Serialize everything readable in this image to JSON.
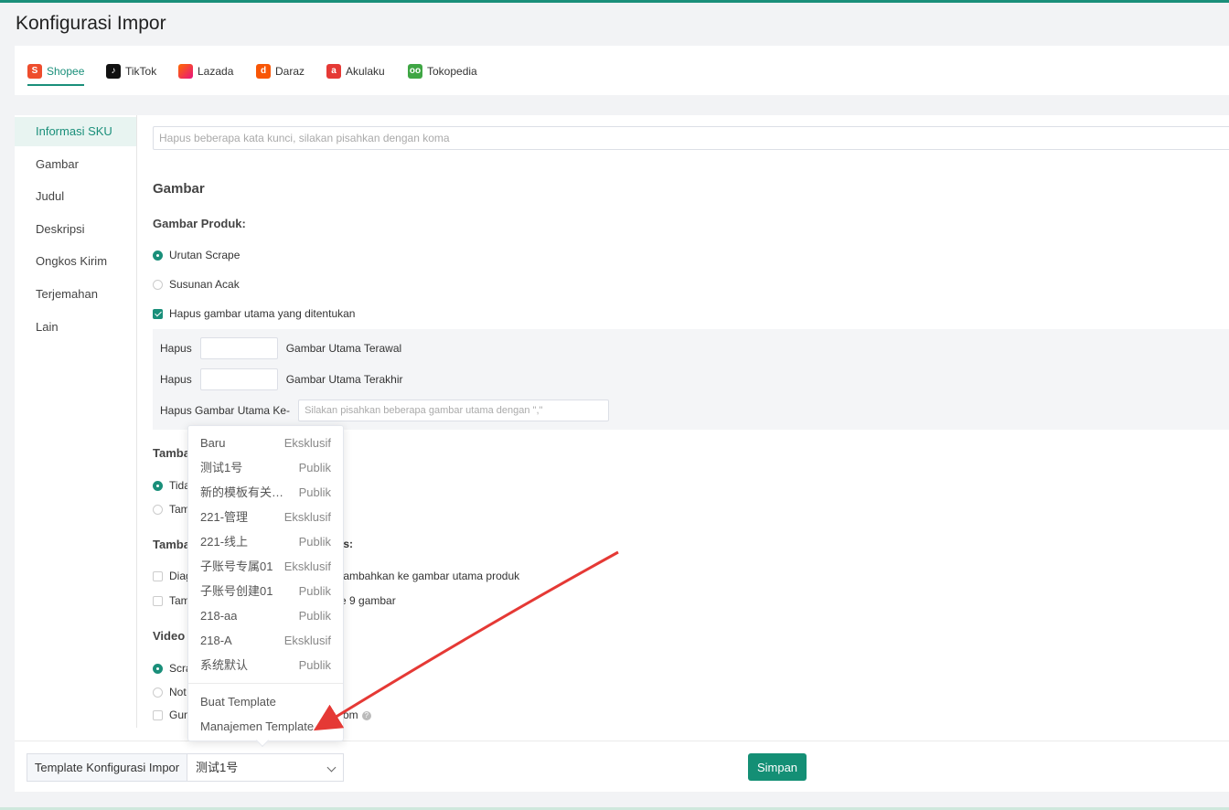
{
  "page": {
    "title": "Konfigurasi Impor"
  },
  "platforms": [
    {
      "label": "Shopee",
      "icon": "shopee-bag-icon",
      "active": true
    },
    {
      "label": "TikTok",
      "icon": "tiktok-icon",
      "active": false
    },
    {
      "label": "Lazada",
      "icon": "lazada-heart-icon",
      "active": false
    },
    {
      "label": "Daraz",
      "icon": "daraz-icon",
      "active": false
    },
    {
      "label": "Akulaku",
      "icon": "akulaku-icon",
      "active": false
    },
    {
      "label": "Tokopedia",
      "icon": "tokopedia-owl-icon",
      "active": false
    }
  ],
  "sidebar": {
    "items": [
      {
        "label": "Informasi SKU",
        "active": true
      },
      {
        "label": "Gambar"
      },
      {
        "label": "Judul"
      },
      {
        "label": "Deskripsi"
      },
      {
        "label": "Ongkos Kirim"
      },
      {
        "label": "Terjemahan"
      },
      {
        "label": "Lain"
      }
    ]
  },
  "keywords": {
    "placeholder": "Hapus beberapa kata kunci, silakan pisahkan dengan koma"
  },
  "gambar": {
    "section_title": "Gambar",
    "product_label": "Gambar Produk:",
    "opt_scrape": "Urutan Scrape",
    "opt_random": "Susunan Acak",
    "remove_main": "Hapus gambar utama yang ditentukan",
    "hapus": "Hapus",
    "first_main": "Gambar Utama Terawal",
    "last_main": "Gambar Utama Terakhir",
    "nth_label": "Hapus Gambar Utama Ke-",
    "nth_placeholder": "Silakan pisahkan beberapa gambar utama dengan \",\""
  },
  "partial": {
    "row1": "Tamba",
    "row2_radio": "Tida",
    "row3_radio": "Tam",
    "row4": "Tamba",
    "row4_tail": "is:",
    "row5_check": "Diag",
    "row5_tail": "tambahkan ke gambar utama produk",
    "row6_check": "Tam",
    "row6_tail": "e 9 gambar",
    "video": "Video",
    "v1": "Scra",
    "v2": "Not",
    "v3": "Gun",
    "v3_tail": "om"
  },
  "dropdown": {
    "items": [
      {
        "name": "Baru",
        "tag": "Eksklusif"
      },
      {
        "name": "测试1号",
        "tag": "Publik"
      },
      {
        "name": "新的模板有关键字",
        "tag": "Publik"
      },
      {
        "name": "221-管理",
        "tag": "Eksklusif"
      },
      {
        "name": "221-线上",
        "tag": "Publik"
      },
      {
        "name": "子账号专属01",
        "tag": "Eksklusif"
      },
      {
        "name": "子账号创建01",
        "tag": "Publik"
      },
      {
        "name": "218-aa",
        "tag": "Publik"
      },
      {
        "name": "218-A",
        "tag": "Eksklusif"
      },
      {
        "name": "系统默认",
        "tag": "Publik"
      }
    ],
    "create": "Buat Template",
    "manage": "Manajemen Template"
  },
  "footer": {
    "template_label": "Template Konfigurasi Impor",
    "template_value": "测试1号",
    "save": "Simpan"
  },
  "colors": {
    "accent": "#1a8f7a",
    "save": "#148f75",
    "annotation_arrow": "#e53935"
  }
}
